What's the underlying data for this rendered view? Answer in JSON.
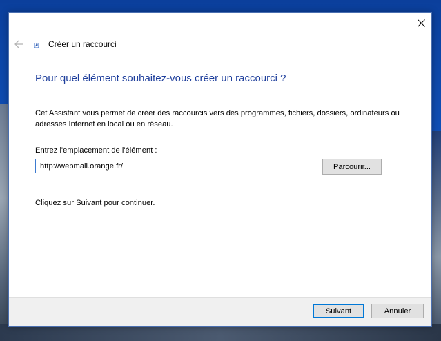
{
  "dialog": {
    "title": "Créer un raccourci",
    "heading": "Pour quel élément souhaitez-vous créer un raccourci ?",
    "description": "Cet Assistant vous permet de créer des raccourcis vers des programmes, fichiers, dossiers, ordinateurs ou adresses Internet en local ou en réseau.",
    "location_label": "Entrez l'emplacement de l'élément :",
    "location_value": "http://webmail.orange.fr/",
    "browse_label": "Parcourir...",
    "continue_text": "Cliquez sur Suivant pour continuer.",
    "next_label": "Suivant",
    "cancel_label": "Annuler"
  },
  "icons": {
    "close": "close-icon",
    "back": "back-arrow-icon",
    "wizard": "shortcut-icon"
  },
  "colors": {
    "heading": "#1f3f9c",
    "focus_border": "#0078d7",
    "desktop": "#0b3f9c"
  }
}
